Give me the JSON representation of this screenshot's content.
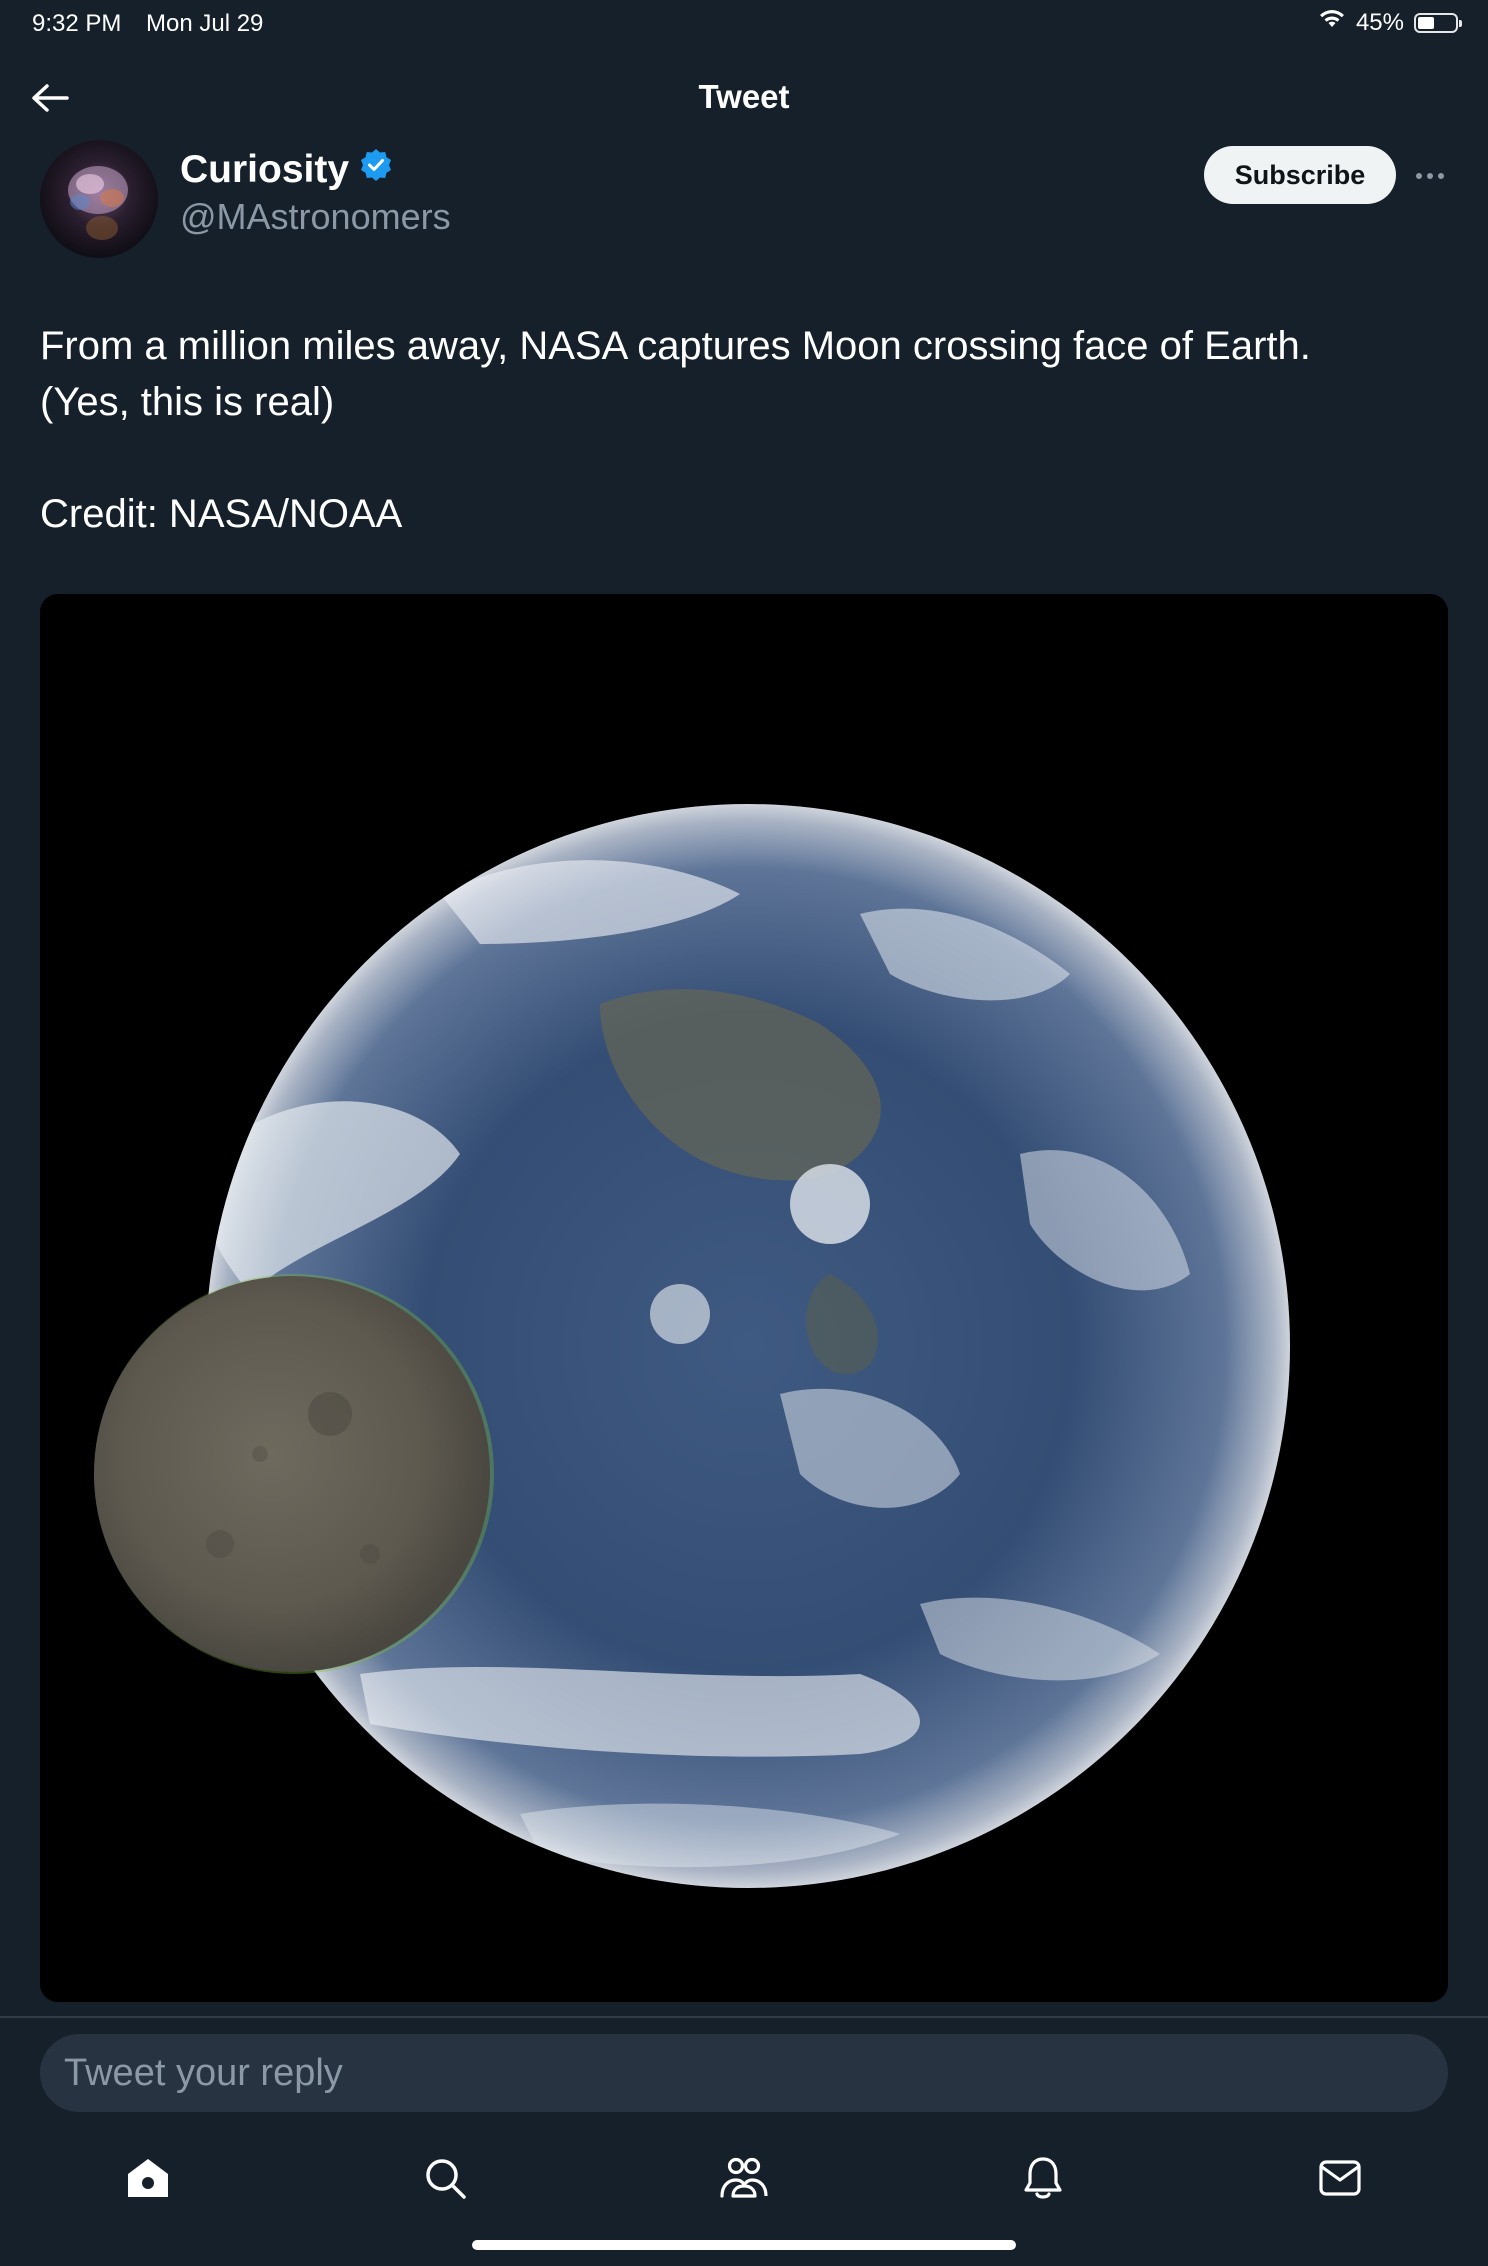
{
  "status_bar": {
    "time": "9:32 PM",
    "date": "Mon Jul 29",
    "battery": "45%",
    "battery_level": 0.45,
    "wifi_icon": "wifi-icon"
  },
  "header": {
    "title": "Tweet",
    "back_icon": "arrow-left-icon"
  },
  "tweet": {
    "author": {
      "name": "Curiosity",
      "handle": "@MAstronomers",
      "verified": true,
      "verified_color": "#1d9bf0"
    },
    "subscribe_label": "Subscribe",
    "more_icon": "ellipsis-icon",
    "text_line1": "From a million miles away, NASA captures Moon crossing face of Earth.",
    "text_line2": "(Yes, this is real)",
    "credit": "Credit: NASA/NOAA"
  },
  "reply": {
    "placeholder": "Tweet your reply"
  },
  "tab_bar": {
    "items": [
      "home-icon",
      "search-icon",
      "communities-icon",
      "notifications-icon",
      "messages-icon"
    ]
  },
  "colors": {
    "background": "#15202b",
    "secondary_text": "#8b98a5",
    "accent": "#1d9bf0",
    "reply_field": "#273340"
  }
}
